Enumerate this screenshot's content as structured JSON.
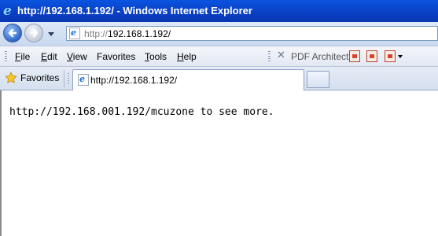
{
  "window": {
    "title": "http://192.168.1.192/ - Windows Internet Explorer",
    "icon": "ie-logo-icon"
  },
  "navigation": {
    "back_icon": "back-arrow-icon",
    "forward_icon": "forward-arrow-icon",
    "address": {
      "protocol": "http://",
      "host": "192.168.1.192/"
    }
  },
  "menu": {
    "items": [
      {
        "label_first": "F",
        "label_rest": "ile"
      },
      {
        "label_first": "E",
        "label_rest": "dit"
      },
      {
        "label_first": "V",
        "label_rest": "iew"
      },
      {
        "label_first": "",
        "label_rest": "Favorites"
      },
      {
        "label_first": "T",
        "label_rest": "ools"
      },
      {
        "label_first": "H",
        "label_rest": "elp"
      }
    ],
    "pdf_architect": "PDF Architect"
  },
  "tabs": {
    "favorites_label": "Favorites",
    "active_tab_label": "http://192.168.1.192/"
  },
  "page": {
    "message": "http://192.168.001.192/mcuzone to see more."
  },
  "colors": {
    "titlebar": "#0a54e0",
    "accent": "#1d6fd6"
  }
}
